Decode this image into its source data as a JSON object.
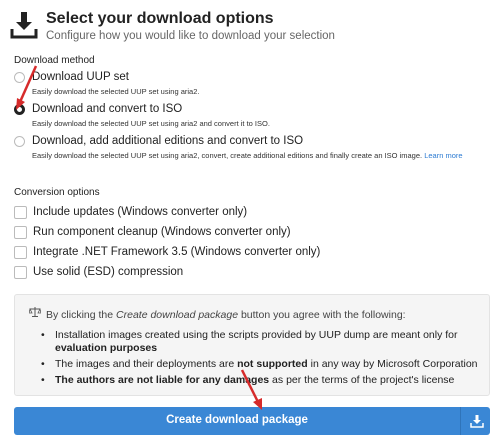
{
  "header": {
    "title": "Select your download options",
    "subtitle": "Configure how you would like to download your selection",
    "icon": "download-icon"
  },
  "download_method": {
    "label": "Download method",
    "options": [
      {
        "label": "Download UUP set",
        "description": "Easily download the selected UUP set using aria2.",
        "checked": false
      },
      {
        "label": "Download and convert to ISO",
        "description": "Easily download the selected UUP set using aria2 and convert it to ISO.",
        "checked": true
      },
      {
        "label": "Download, add additional editions and convert to ISO",
        "description": "Easily download the selected UUP set using aria2, convert, create additional editions and finally create an ISO image.",
        "link": "Learn more",
        "checked": false
      }
    ]
  },
  "conversion_options": {
    "label": "Conversion options",
    "options": [
      {
        "label": "Include updates (Windows converter only)",
        "checked": false
      },
      {
        "label": "Run component cleanup (Windows converter only)",
        "checked": false
      },
      {
        "label": "Integrate .NET Framework 3.5 (Windows converter only)",
        "checked": false
      },
      {
        "label": "Use solid (ESD) compression",
        "checked": false
      }
    ]
  },
  "notice": {
    "icon": "scale-icon",
    "intro_before": "By clicking the ",
    "intro_emph": "Create download package",
    "intro_after": " button you agree with the following:",
    "items": [
      {
        "text": "Installation images created using the scripts provided by UUP dump are meant only for ",
        "bold": "evaluation purposes",
        "after": ""
      },
      {
        "text": "The images and their deployments are ",
        "bold": "not supported",
        "after": " in any way by Microsoft Corporation"
      },
      {
        "text": "",
        "bold": "The authors are not liable for any damages",
        "after": " as per the terms of the project's license"
      }
    ]
  },
  "button": {
    "label": "Create download package",
    "icon": "download-icon"
  },
  "colors": {
    "button": "#3a87d5",
    "annotation_arrow": "#d62b2b",
    "link": "#2c7bd2"
  }
}
